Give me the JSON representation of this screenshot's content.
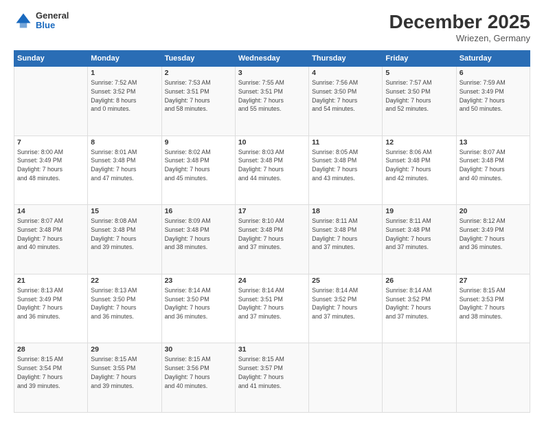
{
  "header": {
    "logo": {
      "general": "General",
      "blue": "Blue"
    },
    "title": "December 2025",
    "subtitle": "Wriezen, Germany"
  },
  "calendar": {
    "days_of_week": [
      "Sunday",
      "Monday",
      "Tuesday",
      "Wednesday",
      "Thursday",
      "Friday",
      "Saturday"
    ],
    "weeks": [
      [
        {
          "day": "",
          "info": ""
        },
        {
          "day": "1",
          "info": "Sunrise: 7:52 AM\nSunset: 3:52 PM\nDaylight: 8 hours\nand 0 minutes."
        },
        {
          "day": "2",
          "info": "Sunrise: 7:53 AM\nSunset: 3:51 PM\nDaylight: 7 hours\nand 58 minutes."
        },
        {
          "day": "3",
          "info": "Sunrise: 7:55 AM\nSunset: 3:51 PM\nDaylight: 7 hours\nand 55 minutes."
        },
        {
          "day": "4",
          "info": "Sunrise: 7:56 AM\nSunset: 3:50 PM\nDaylight: 7 hours\nand 54 minutes."
        },
        {
          "day": "5",
          "info": "Sunrise: 7:57 AM\nSunset: 3:50 PM\nDaylight: 7 hours\nand 52 minutes."
        },
        {
          "day": "6",
          "info": "Sunrise: 7:59 AM\nSunset: 3:49 PM\nDaylight: 7 hours\nand 50 minutes."
        }
      ],
      [
        {
          "day": "7",
          "info": "Sunrise: 8:00 AM\nSunset: 3:49 PM\nDaylight: 7 hours\nand 48 minutes."
        },
        {
          "day": "8",
          "info": "Sunrise: 8:01 AM\nSunset: 3:48 PM\nDaylight: 7 hours\nand 47 minutes."
        },
        {
          "day": "9",
          "info": "Sunrise: 8:02 AM\nSunset: 3:48 PM\nDaylight: 7 hours\nand 45 minutes."
        },
        {
          "day": "10",
          "info": "Sunrise: 8:03 AM\nSunset: 3:48 PM\nDaylight: 7 hours\nand 44 minutes."
        },
        {
          "day": "11",
          "info": "Sunrise: 8:05 AM\nSunset: 3:48 PM\nDaylight: 7 hours\nand 43 minutes."
        },
        {
          "day": "12",
          "info": "Sunrise: 8:06 AM\nSunset: 3:48 PM\nDaylight: 7 hours\nand 42 minutes."
        },
        {
          "day": "13",
          "info": "Sunrise: 8:07 AM\nSunset: 3:48 PM\nDaylight: 7 hours\nand 40 minutes."
        }
      ],
      [
        {
          "day": "14",
          "info": "Sunrise: 8:07 AM\nSunset: 3:48 PM\nDaylight: 7 hours\nand 40 minutes."
        },
        {
          "day": "15",
          "info": "Sunrise: 8:08 AM\nSunset: 3:48 PM\nDaylight: 7 hours\nand 39 minutes."
        },
        {
          "day": "16",
          "info": "Sunrise: 8:09 AM\nSunset: 3:48 PM\nDaylight: 7 hours\nand 38 minutes."
        },
        {
          "day": "17",
          "info": "Sunrise: 8:10 AM\nSunset: 3:48 PM\nDaylight: 7 hours\nand 37 minutes."
        },
        {
          "day": "18",
          "info": "Sunrise: 8:11 AM\nSunset: 3:48 PM\nDaylight: 7 hours\nand 37 minutes."
        },
        {
          "day": "19",
          "info": "Sunrise: 8:11 AM\nSunset: 3:48 PM\nDaylight: 7 hours\nand 37 minutes."
        },
        {
          "day": "20",
          "info": "Sunrise: 8:12 AM\nSunset: 3:49 PM\nDaylight: 7 hours\nand 36 minutes."
        }
      ],
      [
        {
          "day": "21",
          "info": "Sunrise: 8:13 AM\nSunset: 3:49 PM\nDaylight: 7 hours\nand 36 minutes."
        },
        {
          "day": "22",
          "info": "Sunrise: 8:13 AM\nSunset: 3:50 PM\nDaylight: 7 hours\nand 36 minutes."
        },
        {
          "day": "23",
          "info": "Sunrise: 8:14 AM\nSunset: 3:50 PM\nDaylight: 7 hours\nand 36 minutes."
        },
        {
          "day": "24",
          "info": "Sunrise: 8:14 AM\nSunset: 3:51 PM\nDaylight: 7 hours\nand 37 minutes."
        },
        {
          "day": "25",
          "info": "Sunrise: 8:14 AM\nSunset: 3:52 PM\nDaylight: 7 hours\nand 37 minutes."
        },
        {
          "day": "26",
          "info": "Sunrise: 8:14 AM\nSunset: 3:52 PM\nDaylight: 7 hours\nand 37 minutes."
        },
        {
          "day": "27",
          "info": "Sunrise: 8:15 AM\nSunset: 3:53 PM\nDaylight: 7 hours\nand 38 minutes."
        }
      ],
      [
        {
          "day": "28",
          "info": "Sunrise: 8:15 AM\nSunset: 3:54 PM\nDaylight: 7 hours\nand 39 minutes."
        },
        {
          "day": "29",
          "info": "Sunrise: 8:15 AM\nSunset: 3:55 PM\nDaylight: 7 hours\nand 39 minutes."
        },
        {
          "day": "30",
          "info": "Sunrise: 8:15 AM\nSunset: 3:56 PM\nDaylight: 7 hours\nand 40 minutes."
        },
        {
          "day": "31",
          "info": "Sunrise: 8:15 AM\nSunset: 3:57 PM\nDaylight: 7 hours\nand 41 minutes."
        },
        {
          "day": "",
          "info": ""
        },
        {
          "day": "",
          "info": ""
        },
        {
          "day": "",
          "info": ""
        }
      ]
    ]
  }
}
